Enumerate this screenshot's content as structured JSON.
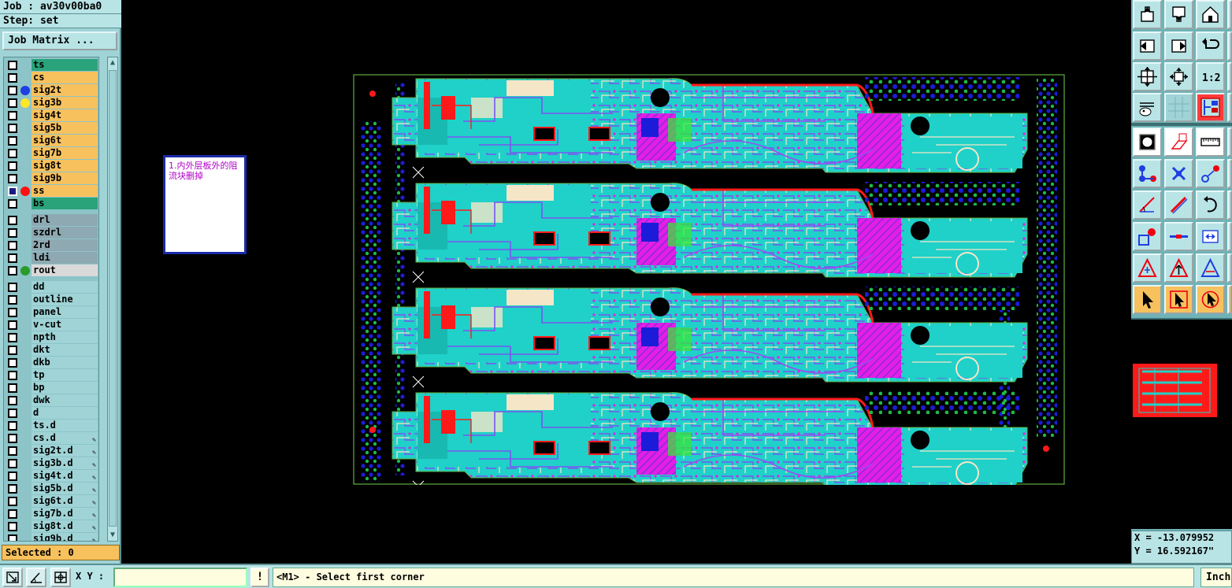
{
  "header": {
    "job_label": "Job : av30v00ba0",
    "step_label": "Step: set",
    "job_matrix_button": "Job Matrix ..."
  },
  "layers": {
    "group_signal": [
      {
        "name": "ts",
        "color": "#2aa37a",
        "dot": null,
        "active": false
      },
      {
        "name": "cs",
        "color": "#f7c15e",
        "dot": null,
        "active": false
      },
      {
        "name": "sig2t",
        "color": "#f7c15e",
        "dot": "#1f3fe0",
        "active": false
      },
      {
        "name": "sig3b",
        "color": "#f7c15e",
        "dot": "#ffe629",
        "active": false
      },
      {
        "name": "sig4t",
        "color": "#f7c15e",
        "dot": null,
        "active": false
      },
      {
        "name": "sig5b",
        "color": "#f7c15e",
        "dot": null,
        "active": false
      },
      {
        "name": "sig6t",
        "color": "#f7c15e",
        "dot": null,
        "active": false
      },
      {
        "name": "sig7b",
        "color": "#f7c15e",
        "dot": null,
        "active": false
      },
      {
        "name": "sig8t",
        "color": "#f7c15e",
        "dot": null,
        "active": false
      },
      {
        "name": "sig9b",
        "color": "#f7c15e",
        "dot": null,
        "active": false
      },
      {
        "name": "ss",
        "color": "#f7c15e",
        "dot": "#ff1010",
        "active": true
      },
      {
        "name": "bs",
        "color": "#2aa37a",
        "dot": null,
        "active": false
      }
    ],
    "group_drill": [
      {
        "name": "drl",
        "color": "#8ea9b2",
        "dot": null
      },
      {
        "name": "szdrl",
        "color": "#8ea9b2",
        "dot": null
      },
      {
        "name": "2rd",
        "color": "#8ea9b2",
        "dot": null
      },
      {
        "name": "ldi",
        "color": "#8ea9b2",
        "dot": null
      },
      {
        "name": "rout",
        "color": "#d9d9d9",
        "dot": "#2a9a2a"
      }
    ],
    "group_misc": [
      {
        "name": "dd",
        "mark": ""
      },
      {
        "name": "outline",
        "mark": ""
      },
      {
        "name": "panel",
        "mark": ""
      },
      {
        "name": "v-cut",
        "mark": ""
      },
      {
        "name": "npth",
        "mark": ""
      },
      {
        "name": "dkt",
        "mark": ""
      },
      {
        "name": "dkb",
        "mark": ""
      },
      {
        "name": "tp",
        "mark": ""
      },
      {
        "name": "bp",
        "mark": ""
      },
      {
        "name": "dwk",
        "mark": ""
      },
      {
        "name": "d",
        "mark": ""
      },
      {
        "name": "ts.d",
        "mark": ""
      },
      {
        "name": "cs.d",
        "mark": "✎"
      },
      {
        "name": "sig2t.d",
        "mark": "✎"
      },
      {
        "name": "sig3b.d",
        "mark": "✎"
      },
      {
        "name": "sig4t.d",
        "mark": "✎"
      },
      {
        "name": "sig5b.d",
        "mark": "✎"
      },
      {
        "name": "sig6t.d",
        "mark": "✎"
      },
      {
        "name": "sig7b.d",
        "mark": "✎"
      },
      {
        "name": "sig8t.d",
        "mark": "✎"
      },
      {
        "name": "sig9b.d",
        "mark": "✎"
      }
    ],
    "misc_color": "#9fd3d6"
  },
  "selected_label": "Selected : 0",
  "note": {
    "text": "1.内外层板外的阻流块删掉"
  },
  "coords": {
    "x": "X = -13.079952",
    "y": "Y = 16.592167\""
  },
  "bottom": {
    "xy_label": "X Y :",
    "xy_value": "",
    "bang_label": "!",
    "prompt": "<M1> - Select first corner",
    "unit": "Inch"
  },
  "colors": {
    "panel_bg": "#9fd3d6",
    "orange": "#f7c15e",
    "board_cyan": "#1fd1c8",
    "board_magenta": "#e41ee6",
    "board_red": "#ff1a1a",
    "board_blue": "#1c1cd8",
    "board_green": "#39e33c",
    "board_cream": "#f5e6c8"
  }
}
